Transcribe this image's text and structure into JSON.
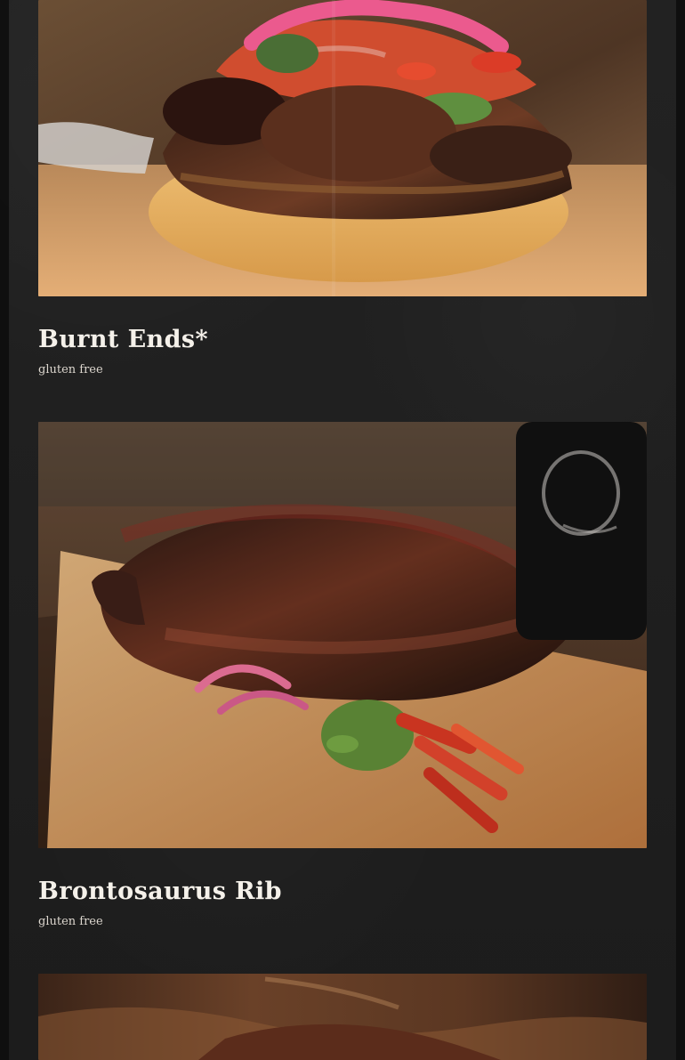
{
  "menu": {
    "items": [
      {
        "name": "Burnt Ends*",
        "note": "gluten free"
      },
      {
        "name": "Brontosaurus Rib",
        "note": "gluten free"
      }
    ]
  },
  "icons": {
    "food_image_1": "burnt-ends-sandwich-photo",
    "food_image_2": "brontosaurus-rib-photo",
    "food_image_3": "cropped-food-photo"
  },
  "colors": {
    "page_background": "#1f1f1f",
    "text_primary": "#f5f1ea",
    "text_secondary": "#ddd7cf"
  }
}
